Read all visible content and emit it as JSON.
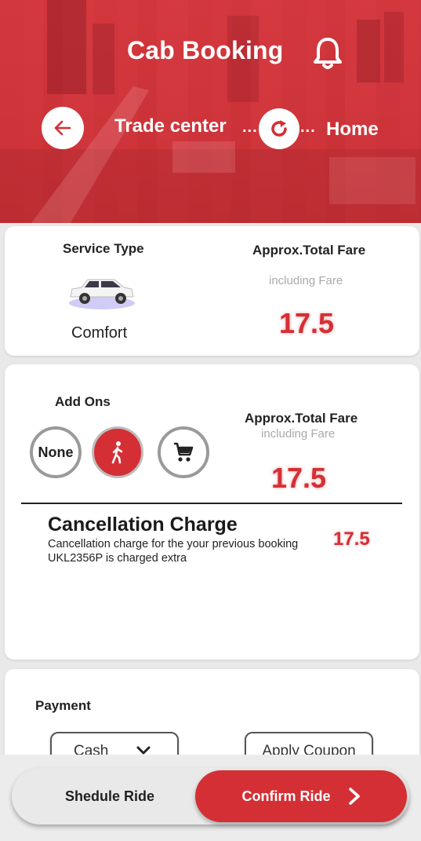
{
  "header": {
    "title": "Cab Booking",
    "from": "Trade center",
    "to": "Home",
    "dots_left": "...",
    "dots_right": "..."
  },
  "service": {
    "type_label": "Service Type",
    "vehicle": "Comfort",
    "fare_title": "Approx.Total Fare",
    "fare_subtitle": "including Fare",
    "fare_value": "17.5"
  },
  "addons": {
    "label": "Add Ons",
    "options": [
      "None",
      "walk",
      "cart"
    ],
    "fare_title": "Approx.Total Fare",
    "fare_subtitle": "including Fare",
    "fare_value": "17.5"
  },
  "cancellation": {
    "title": "Cancellation Charge",
    "description": "Cancellation  charge for the your previous booking  UKL2356P is charged extra",
    "value": "17.5"
  },
  "payment": {
    "label": "Payment",
    "method": "Cash",
    "coupon_label": "Apply Coupon"
  },
  "actions": {
    "schedule_label": "Shedule Ride",
    "confirm_label": "Confirm Ride"
  },
  "colors": {
    "accent": "#d42f35",
    "header_overlay": "#d6383e"
  }
}
